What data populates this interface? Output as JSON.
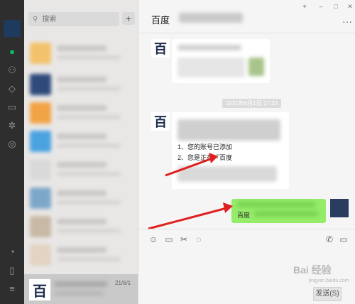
{
  "search": {
    "placeholder": "搜索"
  },
  "add_button_label": "+",
  "selected_contact": {
    "time": "21/6/1"
  },
  "chat": {
    "title": "百度",
    "more_label": "···",
    "timestamp": "2021年6月1日 17:33",
    "message2_lines": [
      "1、您的账号已添加",
      "2、您是正在『百度"
    ],
    "message3_text": "百度"
  },
  "window_controls": {
    "pin": "⌖",
    "minimize": "–",
    "maximize": "□",
    "close": "✕"
  },
  "send_button_label": "发送(S)",
  "watermark": {
    "main": "Bai 经验",
    "sub": "jingyan.baidu.com"
  },
  "avatar_glyph": "百",
  "colors": {
    "nav_bg": "#2e2e2e",
    "nav_active": "#07c160",
    "bubble_green": "#95ec69",
    "arrow_red": "#e02020"
  },
  "icons": {
    "nav": [
      "chat-icon",
      "contacts-icon",
      "favorites-icon",
      "files-icon",
      "gear-icon",
      "moments-icon",
      "explore-icon",
      "phone-icon",
      "menu-icon"
    ],
    "toolbar": [
      "emoji-icon",
      "folder-icon",
      "scissors-icon",
      "chat-bubble-icon",
      "phone-call-icon",
      "video-call-icon"
    ]
  }
}
